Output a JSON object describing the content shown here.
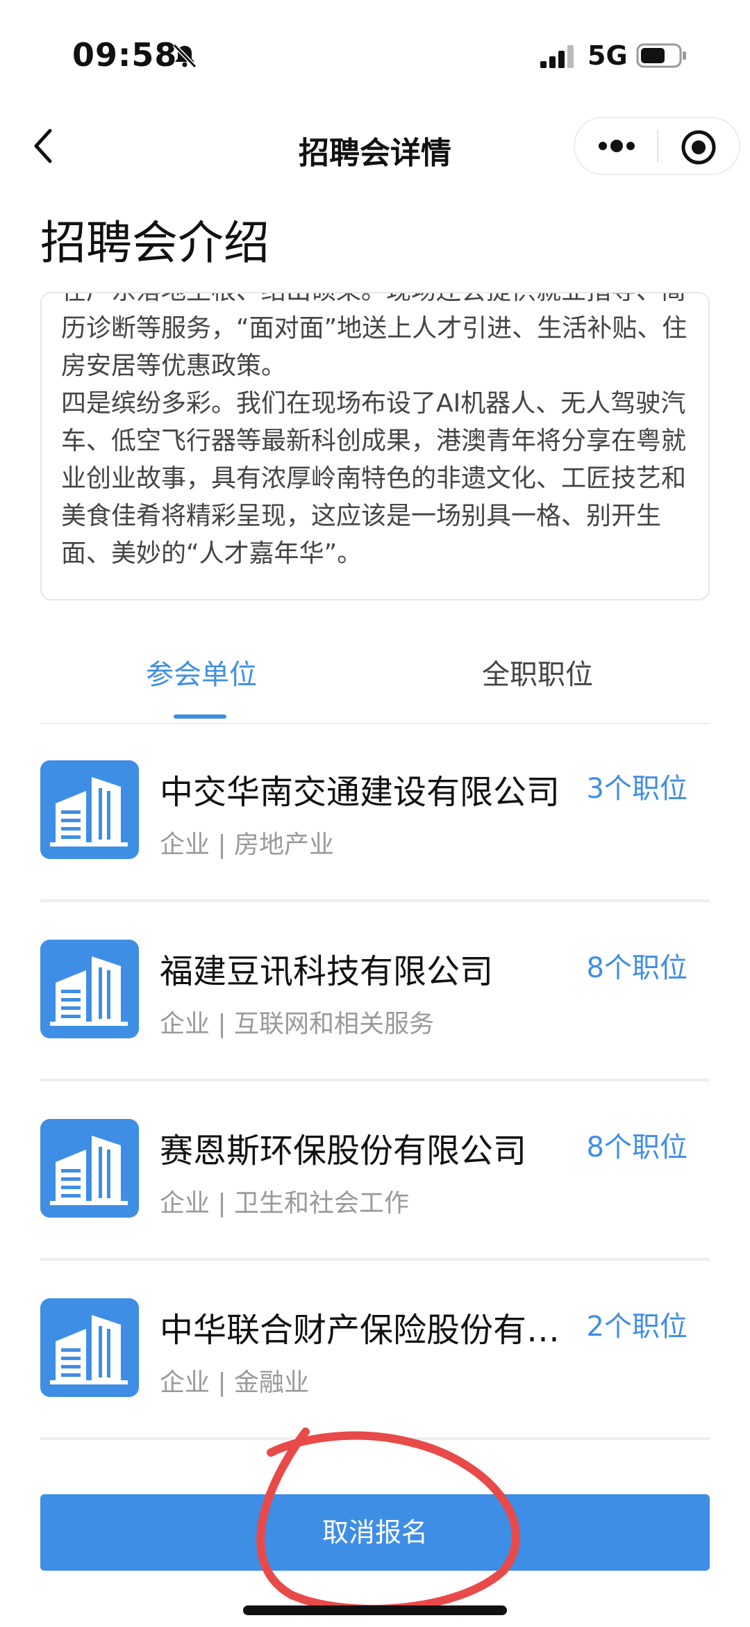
{
  "status_bar": {
    "time": "09:58",
    "network": "5G"
  },
  "nav": {
    "title": "招聘会详情"
  },
  "section": {
    "title": "招聘会介绍"
  },
  "intro": {
    "text": "在广东落地生根、结出硕果。现场还会提供就业指导、简历诊断等服务，“面对面”地送上人才引进、生活补贴、住房安居等优惠政策。\n四是缤纷多彩。我们在现场布设了AI机器人、无人驾驶汽车、低空飞行器等最新科创成果，港澳青年将分享在粤就业创业故事，具有浓厚岭南特色的非遗文化、工匠技艺和美食佳肴将精彩呈现，这应该是一场别具一格、别开生面、美妙的“人才嘉年华”。"
  },
  "tabs": [
    {
      "label": "参会单位",
      "active": true
    },
    {
      "label": "全职职位",
      "active": false
    }
  ],
  "companies": [
    {
      "name": "中交华南交通建设有限公司",
      "meta": "企业 | 房地产业",
      "positions": "3个职位"
    },
    {
      "name": "福建豆讯科技有限公司",
      "meta": "企业 | 互联网和相关服务",
      "positions": "8个职位"
    },
    {
      "name": "赛恩斯环保股份有限公司",
      "meta": "企业 | 卫生和社会工作",
      "positions": "8个职位"
    },
    {
      "name": "中华联合财产保险股份有限公司",
      "meta": "企业 | 金融业",
      "positions": "2个职位"
    }
  ],
  "bottom_button": {
    "label": "取消报名"
  },
  "colors": {
    "accent": "#3f8ee6",
    "annotation": "#e84a4a"
  }
}
